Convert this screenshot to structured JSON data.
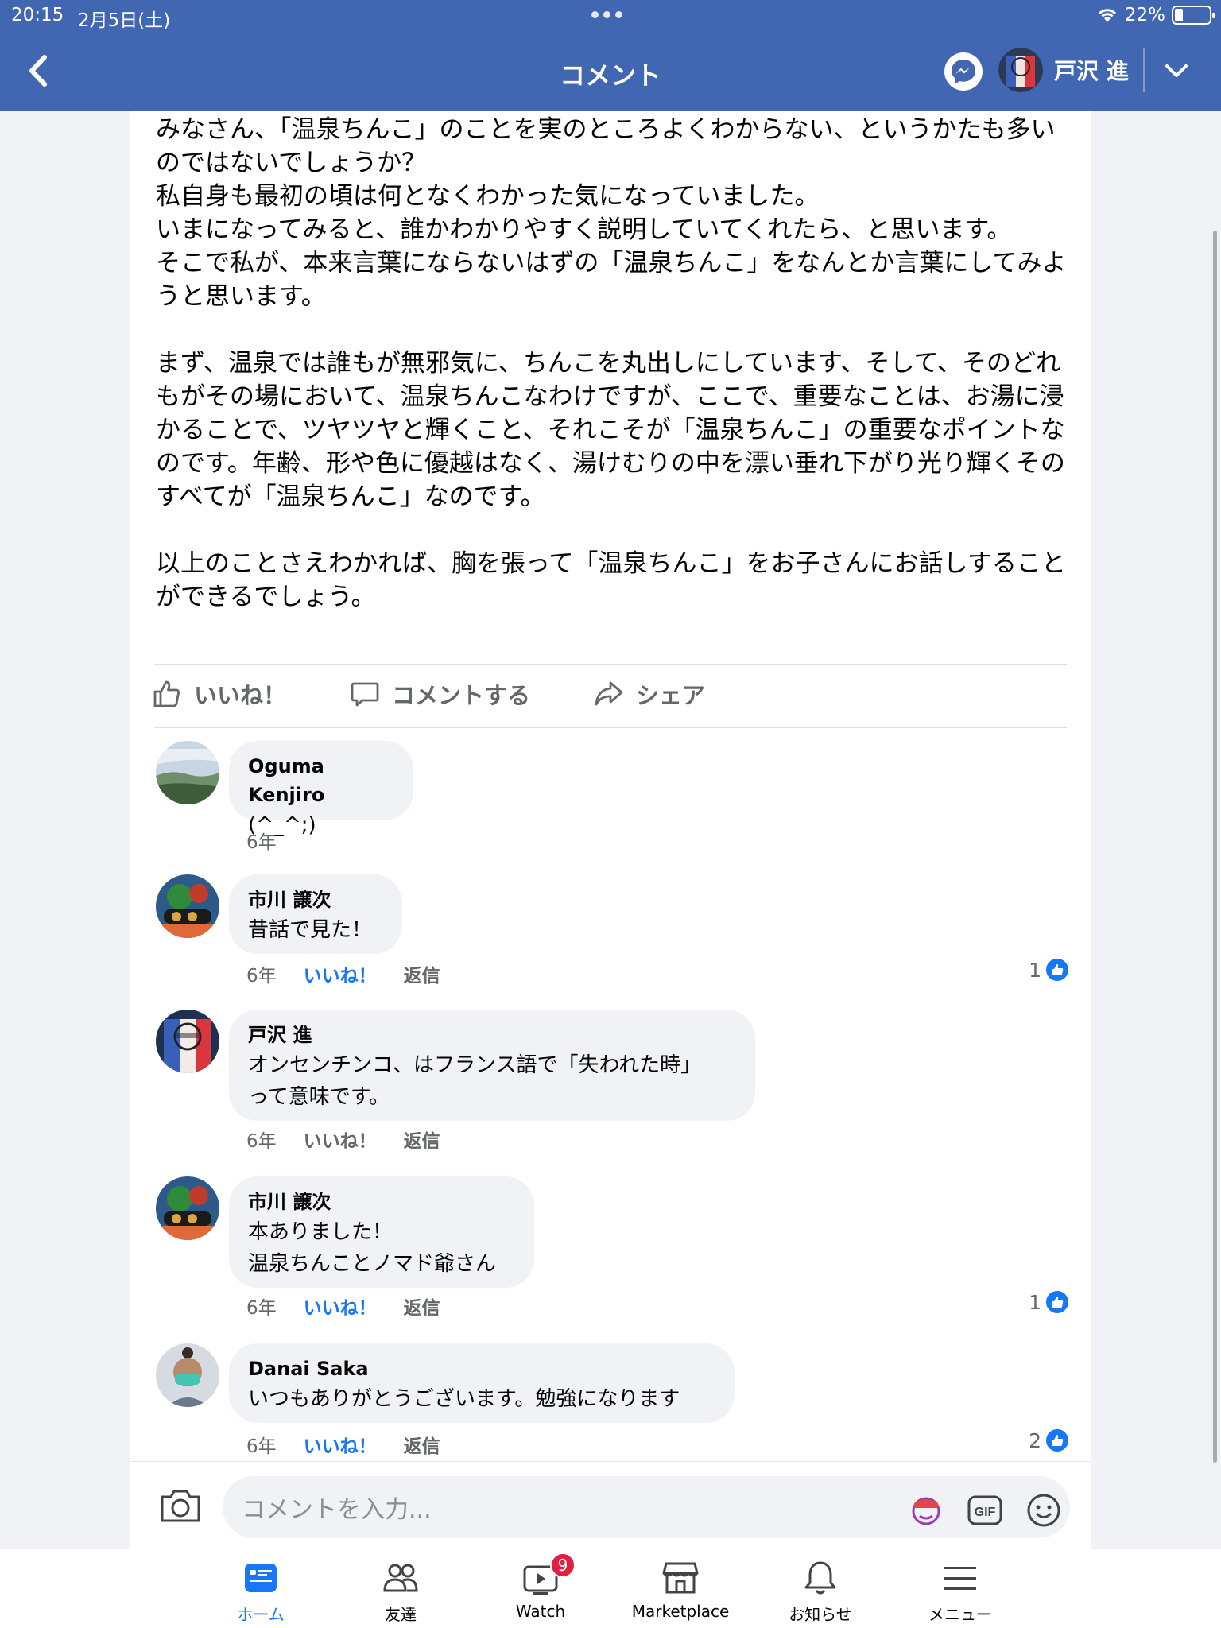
{
  "status_bar": {
    "time": "20:15",
    "date": "2月5日(土)",
    "battery": "22%"
  },
  "header": {
    "title": "コメント",
    "username": "戸沢 進"
  },
  "post": {
    "body": "みなさん、「温泉ちんこ」のことを実のところよくわからない、というかたも多いのではないでしょうか？\n私自身も最初の頃は何となくわかった気になっていました。\nいまになってみると、誰かわかりやすく説明していてくれたら、と思います。\nそこで私が、本来言葉にならないはずの「温泉ちんこ」をなんとか言葉にしてみようと思います。\n\nまず、温泉では誰もが無邪気に、ちんこを丸出しにしています、そして、そのどれもがその場において、温泉ちんこなわけですが、ここで、重要なことは、お湯に浸かることで、ツヤツヤと輝くこと、それこそが「温泉ちんこ」の重要なポイントなのです。年齢、形や色に優越はなく、湯けむりの中を漂い垂れ下がり光り輝くそのすべてが「温泉ちんこ」なのです。\n\n以上のことさえわかれば、胸を張って「温泉ちんこ」をお子さんにお話しすることができるでしょう。",
    "actions": {
      "like": "いいね！",
      "comment": "コメントする",
      "share": "シェア"
    }
  },
  "comments": [
    {
      "name": "Oguma Kenjiro",
      "text": "(^_^;)",
      "time": "6年",
      "like": "",
      "reply": "",
      "likes": ""
    },
    {
      "name": "市川 譲次",
      "text": "昔話で見た！",
      "time": "6年",
      "like": "いいね！",
      "reply": "返信",
      "likes": "1"
    },
    {
      "name": "戸沢 進",
      "text": "オンセンチンコ、はフランス語で「失われた時」\nって意味です。",
      "time": "6年",
      "like": "いいね！",
      "reply": "返信",
      "likes": ""
    },
    {
      "name": "市川 譲次",
      "text": "本ありました！\n温泉ちんことノマド爺さん",
      "time": "6年",
      "like": "いいね！",
      "reply": "返信",
      "likes": "1"
    },
    {
      "name": "Danai Saka",
      "text": "いつもありがとうございます。勉強になります",
      "time": "6年",
      "like": "いいね！",
      "reply": "返信",
      "likes": "2"
    }
  ],
  "composer": {
    "placeholder": "コメントを入力...",
    "gif": "GIF"
  },
  "nav": [
    {
      "label": "ホーム"
    },
    {
      "label": "友達"
    },
    {
      "label": "Watch",
      "badge": "9"
    },
    {
      "label": "Marketplace"
    },
    {
      "label": "お知らせ"
    },
    {
      "label": "メニュー"
    }
  ],
  "colors": {
    "header": "#4267b2",
    "accent": "#1877f2",
    "badge": "#e41e3f"
  }
}
